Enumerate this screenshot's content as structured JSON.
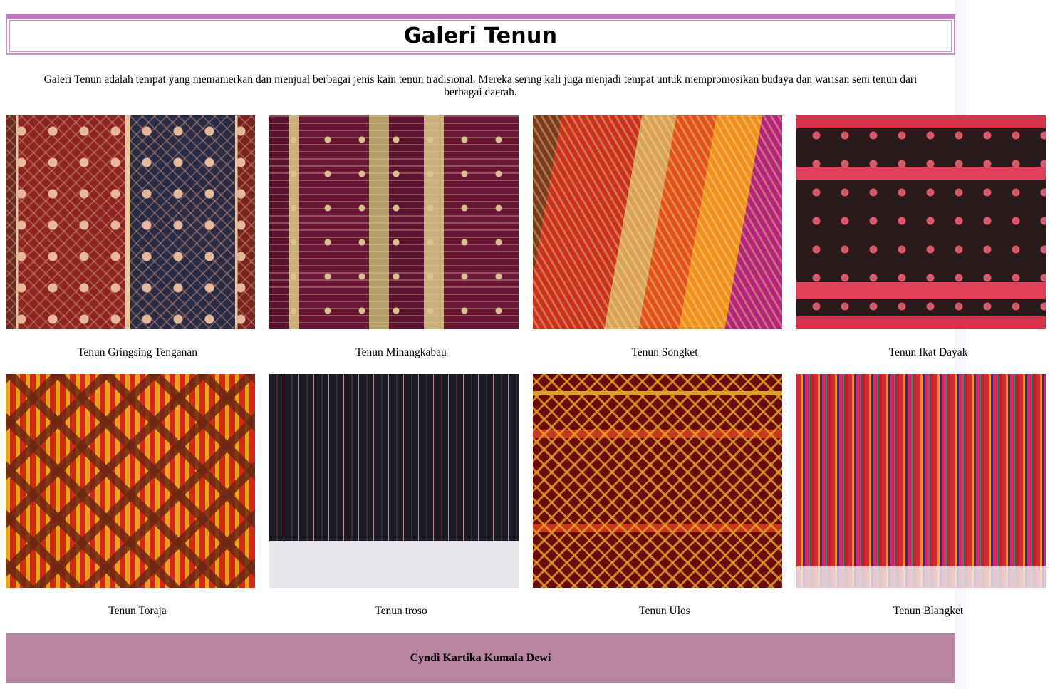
{
  "header": {
    "title": "Galeri Tenun"
  },
  "intro": "Galeri Tenun adalah tempat yang memamerkan dan menjual berbagai jenis kain tenun tradisional. Mereka sering kali juga menjadi tempat untuk mempromosikan budaya dan warisan seni tenun dari berbagai daerah.",
  "gallery": [
    {
      "caption": "Tenun Gringsing Tenganan",
      "image": "textile-gringsing"
    },
    {
      "caption": "Tenun Minangkabau",
      "image": "textile-minangkabau"
    },
    {
      "caption": "Tenun Songket",
      "image": "textile-songket"
    },
    {
      "caption": "Tenun Ikat Dayak",
      "image": "textile-ikat-dayak"
    },
    {
      "caption": "Tenun Toraja",
      "image": "textile-toraja"
    },
    {
      "caption": "Tenun troso",
      "image": "textile-troso"
    },
    {
      "caption": "Tenun Ulos",
      "image": "textile-ulos"
    },
    {
      "caption": "Tenun Blangket",
      "image": "textile-blangket"
    }
  ],
  "footer": {
    "text": "Cyndi Kartika Kumala Dewi"
  },
  "colors": {
    "header_border": "#c575c1",
    "footer_background": "#b785a1"
  }
}
